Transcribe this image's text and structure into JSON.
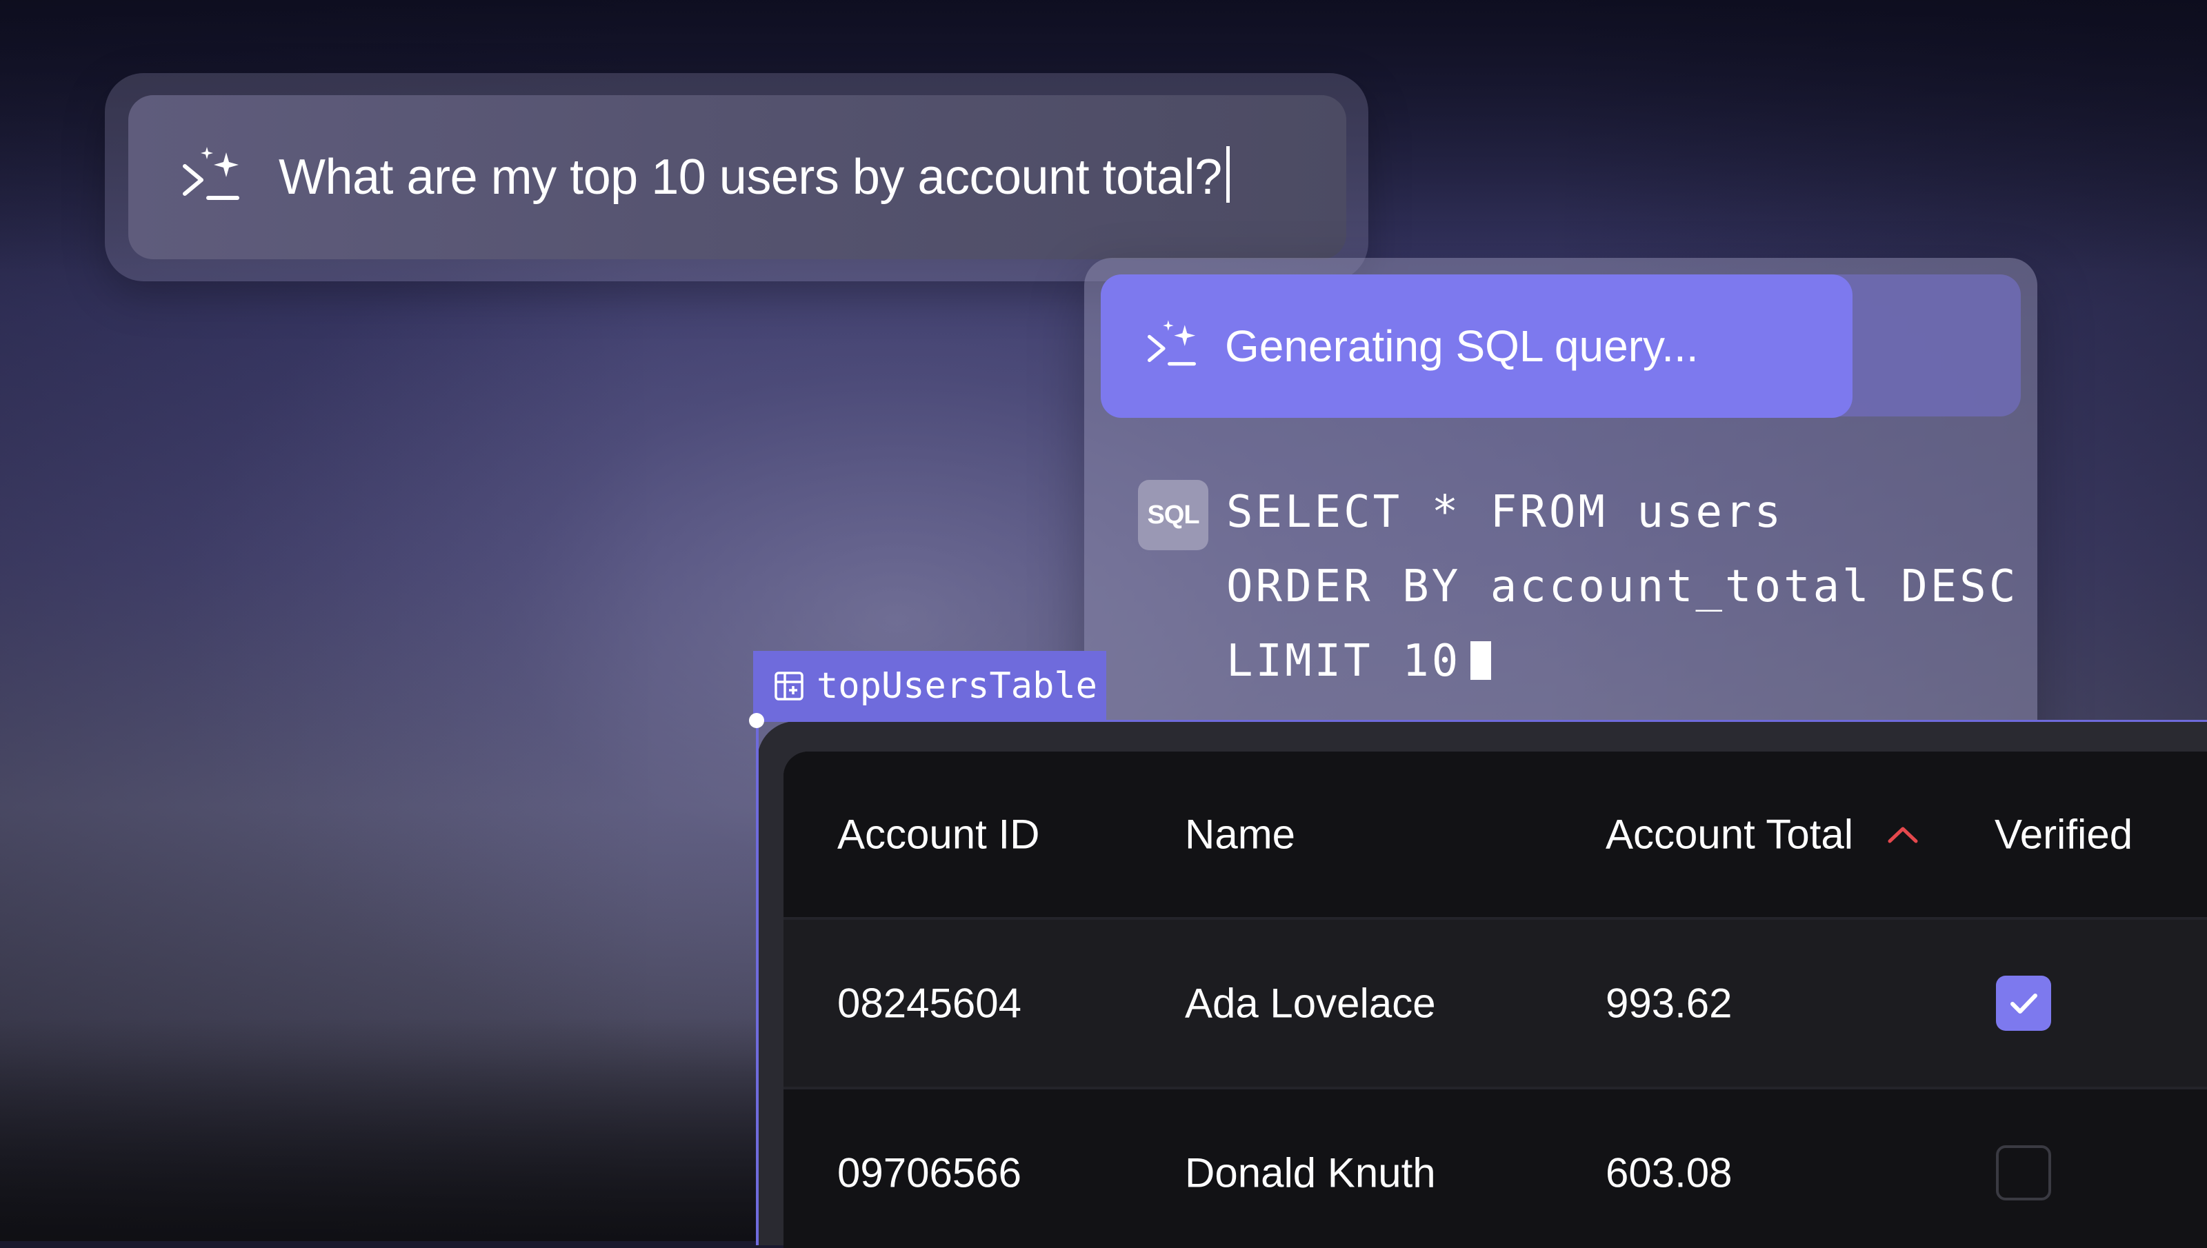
{
  "prompt": {
    "text": "What are my top 10 users by account total?",
    "icon": "sparkle-prompt-icon"
  },
  "assistant": {
    "status": "Generating SQL query...",
    "icon": "sparkle-prompt-icon",
    "accent_color": "#7d79ee"
  },
  "sql": {
    "badge": "SQL",
    "lines": [
      "SELECT * FROM users",
      "ORDER BY account_total DESC",
      "LIMIT 10"
    ]
  },
  "component": {
    "name": "topUsersTable",
    "icon": "table-component-icon"
  },
  "table": {
    "headers": [
      "Account ID",
      "Name",
      "Account Total",
      "Verified"
    ],
    "sort": {
      "column": "Account Total",
      "direction": "desc",
      "color": "#e5484d"
    },
    "rows": [
      {
        "account_id": "08245604",
        "name": "Ada Lovelace",
        "account_total": "993.62",
        "verified": true
      },
      {
        "account_id": "09706566",
        "name": "Donald Knuth",
        "account_total": "603.08",
        "verified": false
      }
    ]
  }
}
